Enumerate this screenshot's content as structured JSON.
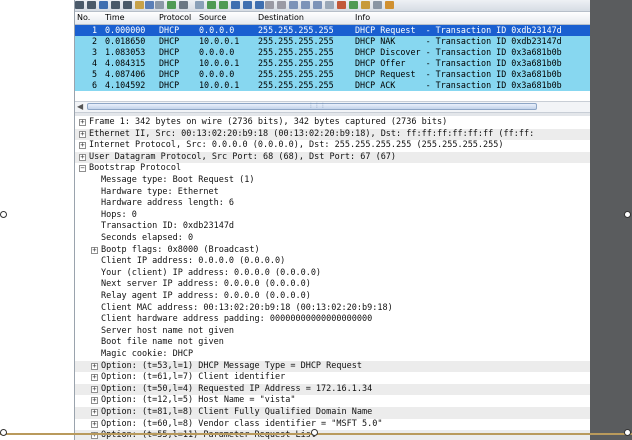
{
  "packet_list": {
    "columns": [
      "No.",
      "Time",
      "Protocol",
      "Source",
      "Destination",
      "Info"
    ],
    "rows": [
      {
        "no": "1",
        "time": "0.000000",
        "protocol": "DHCP",
        "source": "0.0.0.0",
        "destination": "255.255.255.255",
        "info": "DHCP Request  - Transaction ID 0xdb23147d",
        "selected": true
      },
      {
        "no": "2",
        "time": "0.018650",
        "protocol": "DHCP",
        "source": "10.0.0.1",
        "destination": "255.255.255.255",
        "info": "DHCP NAK      - Transaction ID 0xdb23147d",
        "selected": false
      },
      {
        "no": "3",
        "time": "1.083053",
        "protocol": "DHCP",
        "source": "0.0.0.0",
        "destination": "255.255.255.255",
        "info": "DHCP Discover - Transaction ID 0x3a681b0b",
        "selected": false
      },
      {
        "no": "4",
        "time": "4.084315",
        "protocol": "DHCP",
        "source": "10.0.0.1",
        "destination": "255.255.255.255",
        "info": "DHCP Offer    - Transaction ID 0x3a681b0b",
        "selected": false
      },
      {
        "no": "5",
        "time": "4.087406",
        "protocol": "DHCP",
        "source": "0.0.0.0",
        "destination": "255.255.255.255",
        "info": "DHCP Request  - Transaction ID 0x3a681b0b",
        "selected": false
      },
      {
        "no": "6",
        "time": "4.104592",
        "protocol": "DHCP",
        "source": "10.0.0.1",
        "destination": "255.255.255.255",
        "info": "DHCP ACK      - Transaction ID 0x3a681b0b",
        "selected": false
      }
    ]
  },
  "details": [
    {
      "level": 0,
      "expander": "+",
      "text": "Frame 1: 342 bytes on wire (2736 bits), 342 bytes captured (2736 bits)",
      "shade": false
    },
    {
      "level": 0,
      "expander": "+",
      "text": "Ethernet II, Src: 00:13:02:20:b9:18 (00:13:02:20:b9:18), Dst: ff:ff:ff:ff:ff:ff (ff:ff:",
      "shade": true
    },
    {
      "level": 0,
      "expander": "+",
      "text": "Internet Protocol, Src: 0.0.0.0 (0.0.0.0), Dst: 255.255.255.255 (255.255.255.255)",
      "shade": false
    },
    {
      "level": 0,
      "expander": "+",
      "text": "User Datagram Protocol, Src Port: 68 (68), Dst Port: 67 (67)",
      "shade": true
    },
    {
      "level": 0,
      "expander": "-",
      "text": "Bootstrap Protocol",
      "shade": false
    },
    {
      "level": 1,
      "expander": "",
      "text": "Message type: Boot Request (1)",
      "shade": false
    },
    {
      "level": 1,
      "expander": "",
      "text": "Hardware type: Ethernet",
      "shade": false
    },
    {
      "level": 1,
      "expander": "",
      "text": "Hardware address length: 6",
      "shade": false
    },
    {
      "level": 1,
      "expander": "",
      "text": "Hops: 0",
      "shade": false
    },
    {
      "level": 1,
      "expander": "",
      "text": "Transaction ID: 0xdb23147d",
      "shade": false
    },
    {
      "level": 1,
      "expander": "",
      "text": "Seconds elapsed: 0",
      "shade": false
    },
    {
      "level": 1,
      "expander": "+",
      "text": "Bootp flags: 0x8000 (Broadcast)",
      "shade": false
    },
    {
      "level": 1,
      "expander": "",
      "text": "Client IP address: 0.0.0.0 (0.0.0.0)",
      "shade": false
    },
    {
      "level": 1,
      "expander": "",
      "text": "Your (client) IP address: 0.0.0.0 (0.0.0.0)",
      "shade": false
    },
    {
      "level": 1,
      "expander": "",
      "text": "Next server IP address: 0.0.0.0 (0.0.0.0)",
      "shade": false
    },
    {
      "level": 1,
      "expander": "",
      "text": "Relay agent IP address: 0.0.0.0 (0.0.0.0)",
      "shade": false
    },
    {
      "level": 1,
      "expander": "",
      "text": "Client MAC address: 00:13:02:20:b9:18 (00:13:02:20:b9:18)",
      "shade": false
    },
    {
      "level": 1,
      "expander": "",
      "text": "Client hardware address padding: 00000000000000000000",
      "shade": false
    },
    {
      "level": 1,
      "expander": "",
      "text": "Server host name not given",
      "shade": false
    },
    {
      "level": 1,
      "expander": "",
      "text": "Boot file name not given",
      "shade": false
    },
    {
      "level": 1,
      "expander": "",
      "text": "Magic cookie: DHCP",
      "shade": false
    },
    {
      "level": 1,
      "expander": "+",
      "text": "Option: (t=53,l=1) DHCP Message Type = DHCP Request",
      "shade": true
    },
    {
      "level": 1,
      "expander": "+",
      "text": "Option: (t=61,l=7) Client identifier",
      "shade": false
    },
    {
      "level": 1,
      "expander": "+",
      "text": "Option: (t=50,l=4) Requested IP Address = 172.16.1.34",
      "shade": true
    },
    {
      "level": 1,
      "expander": "+",
      "text": "Option: (t=12,l=5) Host Name = \"vista\"",
      "shade": false
    },
    {
      "level": 1,
      "expander": "+",
      "text": "Option: (t=81,l=8) Client Fully Qualified Domain Name",
      "shade": true
    },
    {
      "level": 1,
      "expander": "+",
      "text": "Option: (t=60,l=8) Vendor class identifier = \"MSFT 5.0\"",
      "shade": false
    },
    {
      "level": 1,
      "expander": "+",
      "text": "Option: (t=55,l=11) Parameter Request List",
      "shade": true
    }
  ],
  "colors": {
    "selected_row": "#1a5fd0",
    "dhcp_row": "#87d7f0",
    "right_margin": "#5a5c5e"
  },
  "toolbar_icons": [
    "capture-interfaces-icon",
    "capture-options-icon",
    "start-capture-icon",
    "stop-capture-icon",
    "restart-capture-icon",
    "open-file-icon",
    "save-file-icon",
    "close-file-icon",
    "reload-icon",
    "print-icon",
    "find-packet-icon",
    "go-back-icon",
    "go-forward-icon",
    "go-to-packet-icon",
    "go-first-icon",
    "go-last-icon",
    "colorize-icon",
    "auto-scroll-icon",
    "zoom-in-icon",
    "zoom-out-icon",
    "normal-size-icon",
    "resize-columns-icon",
    "capture-filters-icon",
    "display-filters-icon",
    "coloring-rules-icon",
    "preferences-icon",
    "help-icon"
  ]
}
